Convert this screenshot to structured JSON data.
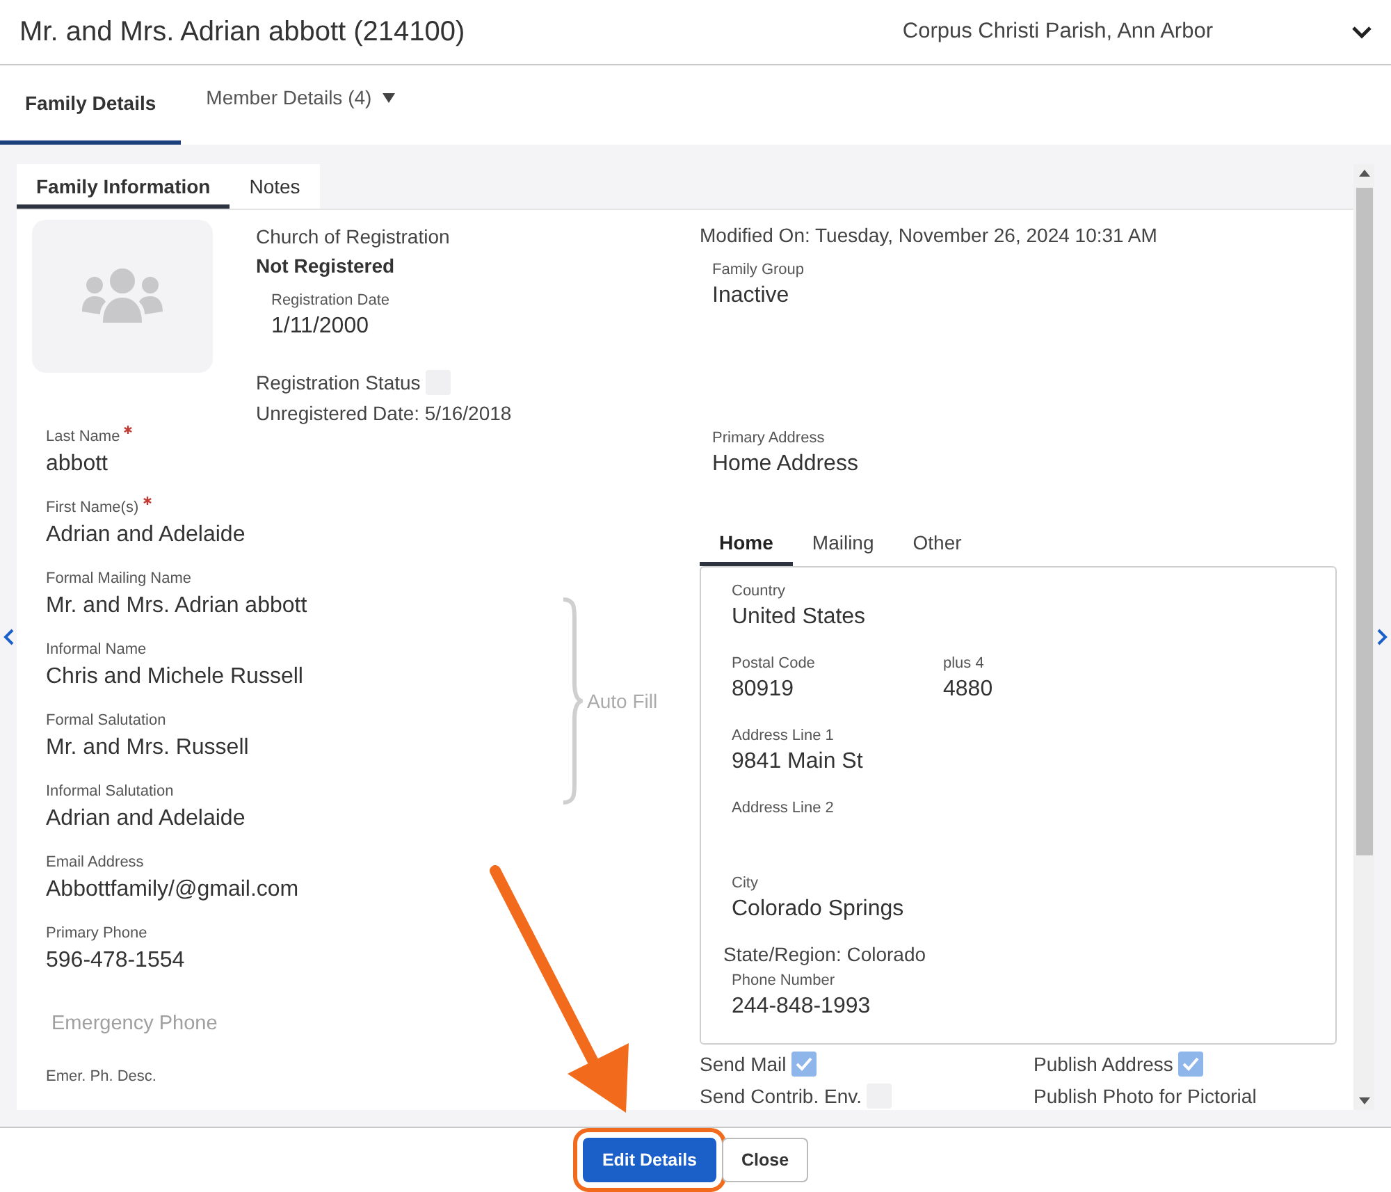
{
  "header": {
    "title": "Mr. and Mrs. Adrian abbott (214100)",
    "parish": "Corpus Christi Parish, Ann Arbor"
  },
  "tabs": [
    {
      "label": "Family Details",
      "selected": true,
      "dropdown": false
    },
    {
      "label": "Member Details (4)",
      "selected": false,
      "dropdown": true
    }
  ],
  "subtabs": [
    {
      "label": "Family Information",
      "selected": true
    },
    {
      "label": "Notes",
      "selected": false
    }
  ],
  "registration": {
    "church_label": "Church of Registration",
    "church_value": "Not Registered",
    "date_label": "Registration Date",
    "date_value": "1/11/2000",
    "status_label": "Registration Status",
    "status_checked": false,
    "unregistered": "Unregistered Date: 5/16/2018"
  },
  "name_fields": [
    {
      "label": "Last Name",
      "value": "abbott",
      "required": true
    },
    {
      "label": "First Name(s)",
      "value": "Adrian and Adelaide",
      "required": true
    }
  ],
  "auto_fill": {
    "label": "Auto Fill",
    "fields": [
      {
        "label": "Formal Mailing Name",
        "value": "Mr. and Mrs. Adrian abbott",
        "required": false
      },
      {
        "label": "Informal Name",
        "value": "Chris and Michele Russell",
        "required": false
      },
      {
        "label": "Formal Salutation",
        "value": "Mr. and Mrs. Russell",
        "required": false
      },
      {
        "label": "Informal Salutation",
        "value": "Adrian and Adelaide",
        "required": false
      }
    ]
  },
  "contact_fields": [
    {
      "kind": "field",
      "label": "Email Address",
      "value": "Abbottfamily/@gmail.com"
    },
    {
      "kind": "field",
      "label": "Primary Phone",
      "value": "596-478-1554"
    },
    {
      "kind": "placeholder",
      "placeholder": "Emergency Phone"
    },
    {
      "kind": "label",
      "label": "Emer. Ph. Desc."
    }
  ],
  "modified": "Modified On: Tuesday, November 26, 2024 10:31 AM",
  "family_group": {
    "label": "Family Group",
    "value": "Inactive"
  },
  "primary_address": {
    "label": "Primary Address",
    "value": "Home Address"
  },
  "address_tabs": [
    {
      "label": "Home",
      "selected": true
    },
    {
      "label": "Mailing",
      "selected": false
    },
    {
      "label": "Other",
      "selected": false
    }
  ],
  "address_rows": [
    [
      {
        "label": "Country",
        "value": "United States"
      }
    ],
    [
      {
        "label": "Postal Code",
        "value": "80919"
      },
      {
        "label": "plus 4",
        "value": "4880"
      }
    ],
    [
      {
        "label": "Address Line 1",
        "value": "9841 Main St"
      }
    ],
    [
      {
        "label": "Address Line 2"
      }
    ],
    [
      {
        "label": "City",
        "value": "Colorado Springs"
      }
    ]
  ],
  "state": "State/Region: Colorado",
  "phone": {
    "label": "Phone Number",
    "value": "244-848-1993"
  },
  "flags": [
    {
      "kind": "checkbox",
      "label": "Send Mail",
      "checked": true
    },
    {
      "kind": "checkbox",
      "label": "Publish Address",
      "checked": true
    },
    {
      "kind": "checkbox",
      "label": "Send Contrib. Env.",
      "checked": false
    },
    {
      "kind": "text",
      "label": "Publish Photo for Pictorial"
    }
  ],
  "buttons": [
    {
      "label": "Edit Details",
      "kind": "primary",
      "highlighted": true
    },
    {
      "label": "Close",
      "kind": "secondary",
      "highlighted": false
    }
  ]
}
